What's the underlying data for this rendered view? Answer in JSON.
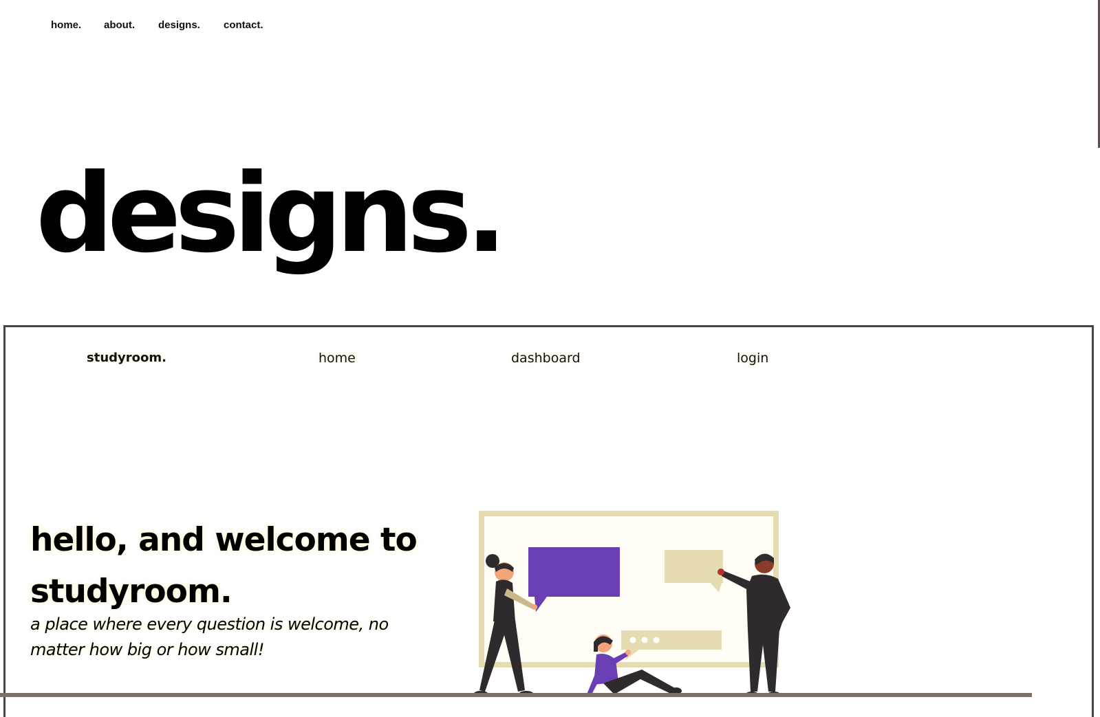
{
  "top_nav": {
    "home": "home.",
    "about": "about.",
    "designs": "designs.",
    "contact": "contact."
  },
  "page_title": "designs.",
  "preview": {
    "nav": {
      "brand": "studyroom.",
      "home": "home",
      "dashboard": "dashboard",
      "login": "login"
    },
    "hero_title": "hello, and welcome to studyroom.",
    "hero_subtitle": "a place where every question is welcome, no matter how big or how small!",
    "colors": {
      "accent_purple": "#6a3fb4",
      "board_beige": "#e6dcb2",
      "figure_dark": "#2f2a2b",
      "skin_light": "#f3a579",
      "skin_dark": "#8a3b2a"
    },
    "illustration_icon": "people-at-board-illustration"
  }
}
